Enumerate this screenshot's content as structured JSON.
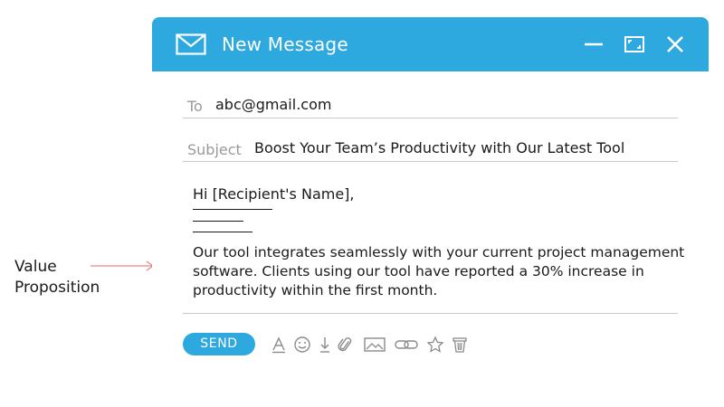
{
  "annotation": {
    "line1": "Value",
    "line2": "Proposition",
    "arrow_color": "#e06a6a"
  },
  "window": {
    "title": "New Message",
    "accent_color": "#2ea9df",
    "controls": [
      "minimize-icon",
      "maximize-icon",
      "close-icon"
    ]
  },
  "fields": {
    "to_label": "To",
    "to_value": "abc@gmail.com",
    "subject_label": "Subject",
    "subject_value": "Boost Your Team’s Productivity with Our Latest Tool"
  },
  "body": {
    "greeting": "Hi [Recipient's Name],",
    "paragraph": "Our tool integrates seamlessly with your current project management software. Clients using our tool have reported a 30% increase in productivity within the first month."
  },
  "toolbar": {
    "send_label": "SEND",
    "tools": [
      "font-icon",
      "emoji-icon",
      "download-icon",
      "attachment-icon",
      "image-icon",
      "link-icon",
      "star-icon",
      "trash-icon"
    ]
  }
}
